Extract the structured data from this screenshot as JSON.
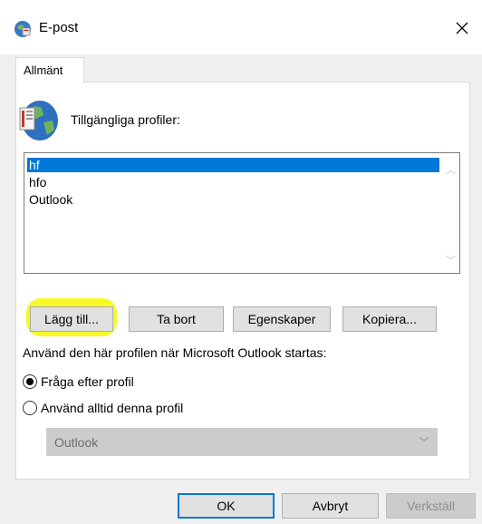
{
  "window": {
    "title": "E-post",
    "close_icon": "close-icon"
  },
  "tabs": [
    {
      "label": "Allmänt"
    }
  ],
  "profiles": {
    "label": "Tillgängliga profiler:",
    "items": [
      {
        "label": "hf",
        "selected": true
      },
      {
        "label": "hfo",
        "selected": false
      },
      {
        "label": "Outlook",
        "selected": false
      }
    ]
  },
  "profile_buttons": {
    "add": "Lägg till...",
    "remove": "Ta bort",
    "properties": "Egenskaper",
    "copy": "Kopiera..."
  },
  "startup": {
    "label": "Använd den här profilen när Microsoft Outlook startas:",
    "option_prompt": "Fråga efter profil",
    "option_always": "Använd alltid denna profil",
    "selected_option": "prompt",
    "profile_select_value": "Outlook"
  },
  "footer": {
    "ok": "OK",
    "cancel": "Avbryt",
    "apply": "Verkställ"
  },
  "colors": {
    "selection": "#0078d7",
    "highlight": "#f6f700"
  }
}
